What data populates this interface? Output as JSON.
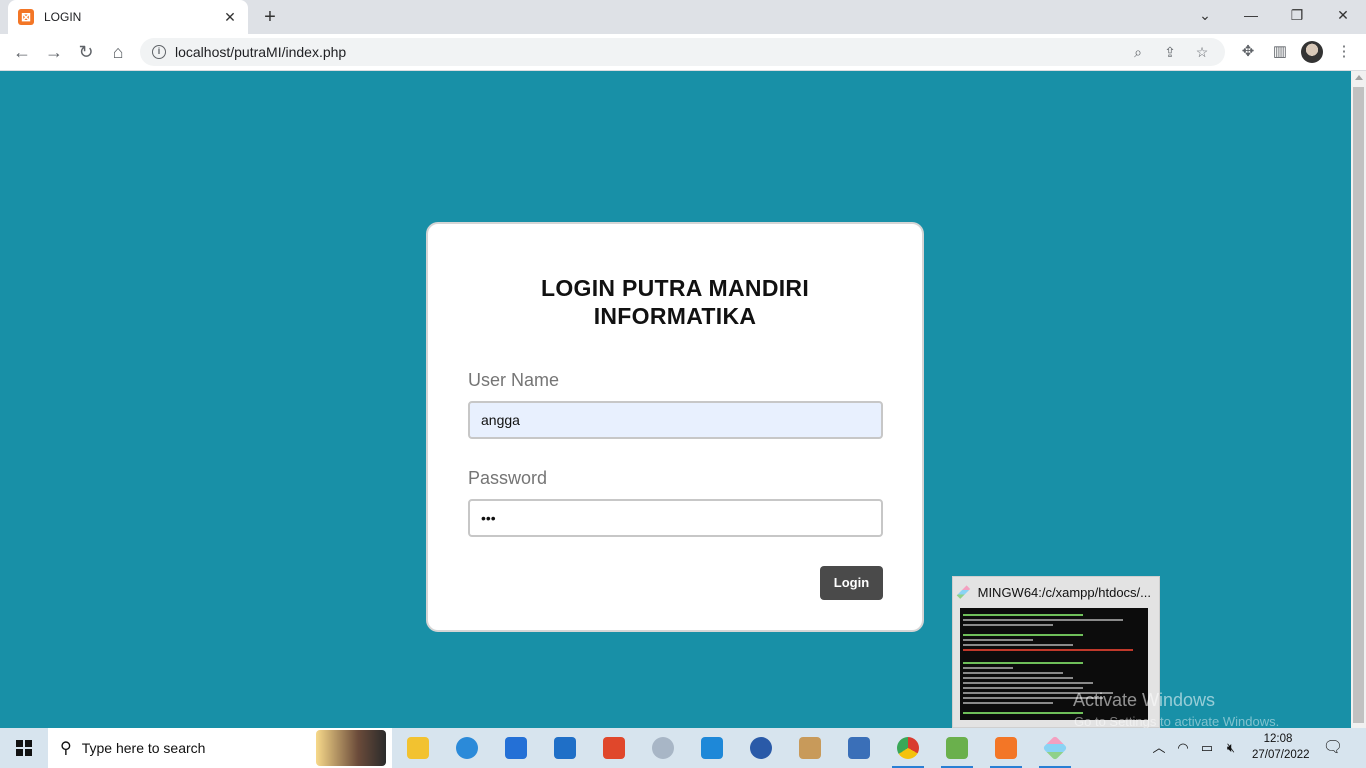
{
  "browser": {
    "tab_title": "LOGIN",
    "tab_favicon_glyph": "⊠",
    "new_tab_glyph": "+",
    "url": "localhost/putraMI/index.php"
  },
  "login": {
    "title_line1": "LOGIN PUTRA MANDIRI",
    "title_line2": "INFORMATIKA",
    "username_label": "User Name",
    "username_value": "angga",
    "password_label": "Password",
    "password_masked": "•••",
    "login_button": "Login"
  },
  "preview": {
    "title": "MINGW64:/c/xampp/htdocs/..."
  },
  "watermark": {
    "line1": "Activate Windows",
    "line2": "Go to Settings to activate Windows."
  },
  "taskbar": {
    "search_placeholder": "Type here to search",
    "time": "12:08",
    "date": "27/07/2022",
    "apps": [
      {
        "name": "file-explorer",
        "color": "#f2c230"
      },
      {
        "name": "edge",
        "color": "#2b8ad9"
      },
      {
        "name": "microsoft-store",
        "color": "#2470d6"
      },
      {
        "name": "mail",
        "color": "#1f6fc7"
      },
      {
        "name": "office",
        "color": "#e0472b"
      },
      {
        "name": "settings-tool",
        "color": "#a8b6c6"
      },
      {
        "name": "vs-code",
        "color": "#1e88d8"
      },
      {
        "name": "app-w",
        "color": "#2a5aa8"
      },
      {
        "name": "paint",
        "color": "#c89a5a"
      },
      {
        "name": "app-window",
        "color": "#3a6fb8"
      },
      {
        "name": "chrome",
        "color": "#d93b2f"
      },
      {
        "name": "notepad-plus",
        "color": "#6ab04c"
      },
      {
        "name": "xampp",
        "color": "#f37626"
      },
      {
        "name": "git-bash",
        "color": "#9ad0a0"
      }
    ]
  },
  "colors": {
    "page_background": "#1890a7",
    "button_background": "#4a4a4a",
    "autofill_background": "#e8f0fe"
  }
}
